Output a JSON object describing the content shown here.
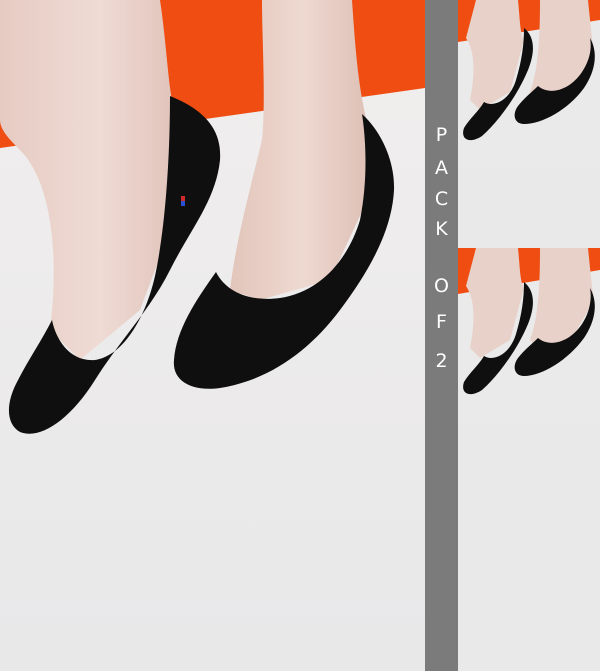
{
  "banner": {
    "letters": [
      "P",
      "A",
      "C",
      "K",
      "O",
      "F",
      "2"
    ]
  },
  "colors": {
    "orange_backdrop": "#ef4d12",
    "floor": "#e9e9ea",
    "band": "#7b7b7b",
    "sock": "#0f0f10",
    "skin": "#e9d3cb"
  }
}
